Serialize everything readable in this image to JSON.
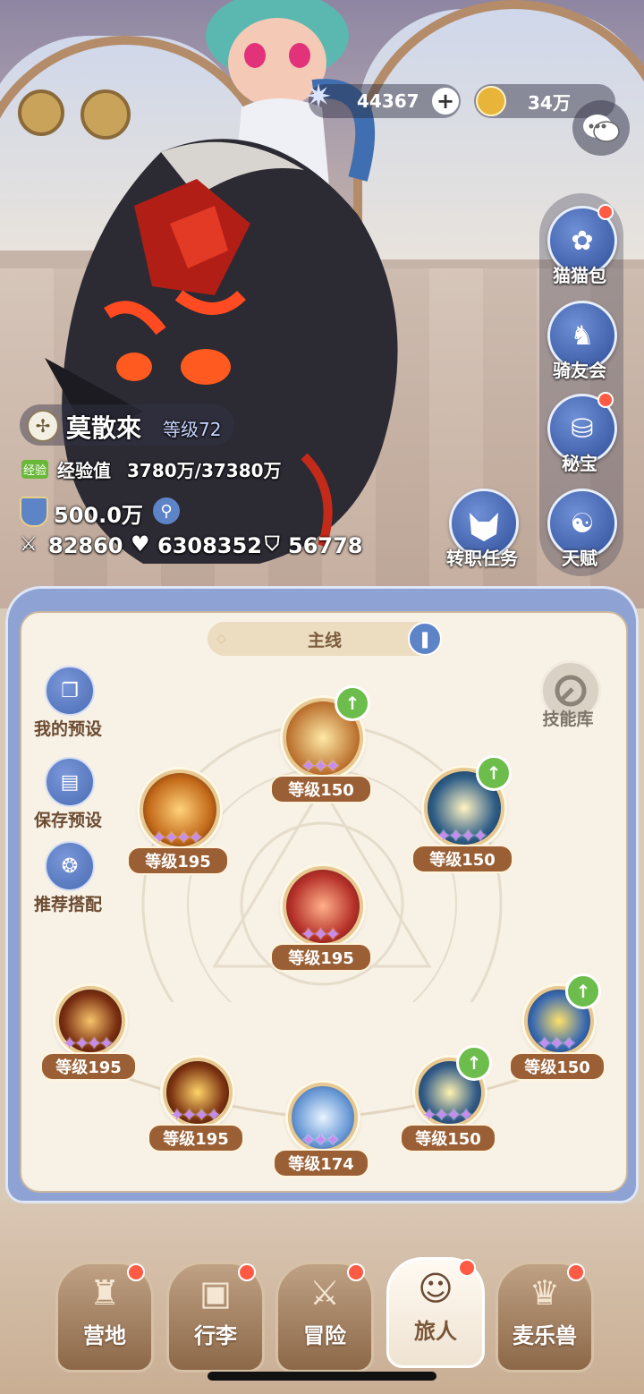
{
  "currency": {
    "crystal_value": "44367",
    "crystal_add": "+",
    "gold_value": "34万"
  },
  "player": {
    "name": "莫散來",
    "level_label": "等级72",
    "exp_badge": "经验",
    "exp_label": "经验值",
    "exp_value": "3780万/37380万",
    "power": "500.0万",
    "attack": "82860",
    "hp": "6308352",
    "defense": "56778"
  },
  "right_menu": [
    {
      "label": "猫猫包",
      "icon": "cat-bag-icon",
      "badge": true
    },
    {
      "label": "骑友会",
      "icon": "horse-icon",
      "badge": false
    },
    {
      "label": "秘宝",
      "icon": "treasure-icon",
      "badge": true
    },
    {
      "label": "天赋",
      "icon": "brain-icon",
      "badge": false
    }
  ],
  "job_task_label": "转职任务",
  "panel": {
    "tab_label": "主线",
    "skill_library": "技能库",
    "side_buttons": [
      {
        "label": "我的预设",
        "icon": "preset-icon"
      },
      {
        "label": "保存预设",
        "icon": "save-icon"
      },
      {
        "label": "推荐搭配",
        "icon": "recommend-icon"
      }
    ],
    "skills": [
      {
        "level": "等级150",
        "stars": "✦✦✦",
        "upgrade": true
      },
      {
        "level": "等级195",
        "stars": "✦✦✦✦",
        "upgrade": false
      },
      {
        "level": "等级150",
        "stars": "✦✦✦✦",
        "upgrade": true
      },
      {
        "level": "等级195",
        "stars": "✦✦✦",
        "upgrade": false
      },
      {
        "level": "等级195",
        "stars": "✦✦✦✦",
        "upgrade": false
      },
      {
        "level": "等级150",
        "stars": "✦✦✦",
        "upgrade": true
      },
      {
        "level": "等级195",
        "stars": "✦✦✦✦",
        "upgrade": false
      },
      {
        "level": "等级150",
        "stars": "✦✦✦✦",
        "upgrade": true
      },
      {
        "level": "等级174",
        "stars": "✦✦✦",
        "upgrade": false
      }
    ]
  },
  "nav": [
    {
      "label": "营地",
      "icon": "castle-icon",
      "badge": true,
      "active": false
    },
    {
      "label": "行李",
      "icon": "backpack-icon",
      "badge": true,
      "active": false
    },
    {
      "label": "冒险",
      "icon": "swords-icon",
      "badge": true,
      "active": false
    },
    {
      "label": "旅人",
      "icon": "traveler-icon",
      "badge": true,
      "active": true
    },
    {
      "label": "麦乐兽",
      "icon": "cat-face-icon",
      "badge": true,
      "active": false
    }
  ],
  "colors": {
    "accent": "#4a6cb5",
    "level_chip": "#9a5f35",
    "upgrade": "#6dbd4c",
    "badge": "#ff5a44"
  }
}
